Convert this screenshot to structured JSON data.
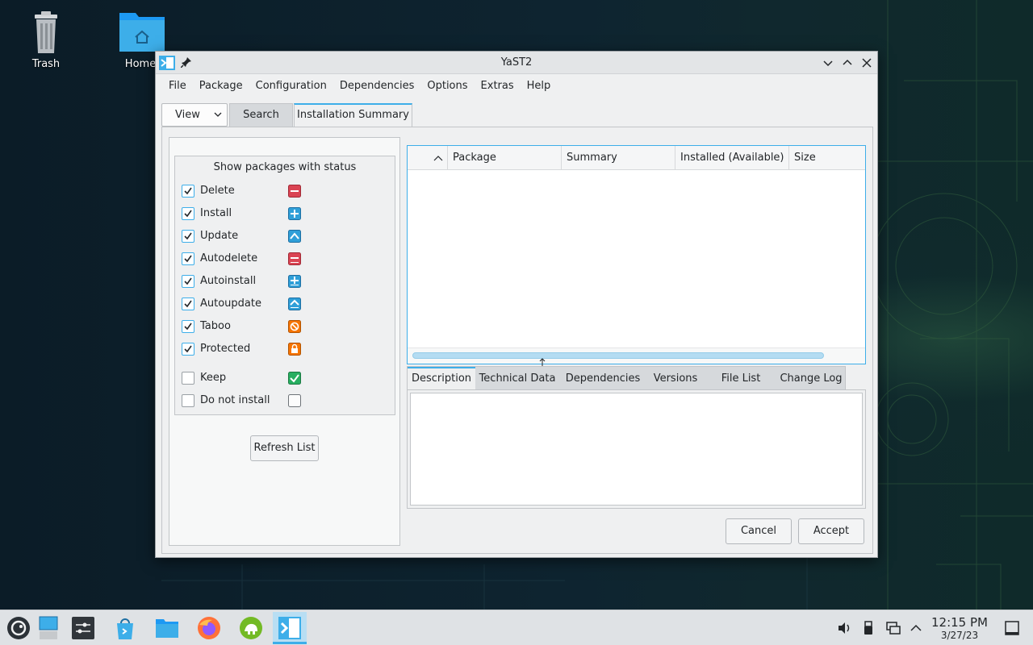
{
  "desktop": {
    "icons": [
      {
        "label": "Trash"
      },
      {
        "label": "Home"
      }
    ]
  },
  "window": {
    "title": "YaST2",
    "menu": [
      "File",
      "Package",
      "Configuration",
      "Dependencies",
      "Options",
      "Extras",
      "Help"
    ],
    "view_combo": "View",
    "tabs": [
      {
        "label": "Search",
        "active": false
      },
      {
        "label": "Installation Summary",
        "active": true
      }
    ],
    "status_filter": {
      "heading": "Show packages with status",
      "items": [
        {
          "label": "Delete",
          "checked": true,
          "icon": "delete-status-icon"
        },
        {
          "label": "Install",
          "checked": true,
          "icon": "install-status-icon"
        },
        {
          "label": "Update",
          "checked": true,
          "icon": "update-status-icon"
        },
        {
          "label": "Autodelete",
          "checked": true,
          "icon": "autodelete-status-icon"
        },
        {
          "label": "Autoinstall",
          "checked": true,
          "icon": "autoinstall-status-icon"
        },
        {
          "label": "Autoupdate",
          "checked": true,
          "icon": "autoupdate-status-icon"
        },
        {
          "label": "Taboo",
          "checked": true,
          "icon": "taboo-status-icon"
        },
        {
          "label": "Protected",
          "checked": true,
          "icon": "protected-status-icon"
        },
        {
          "label": "Keep",
          "checked": false,
          "icon": "keep-status-icon"
        },
        {
          "label": "Do not install",
          "checked": false,
          "icon": "do-not-install-status-icon"
        }
      ],
      "refresh_label": "Refresh List"
    },
    "package_table": {
      "columns": [
        "",
        "Package",
        "Summary",
        "Installed (Available)",
        "Size"
      ],
      "rows": []
    },
    "detail_tabs": [
      {
        "label": "Description",
        "active": true
      },
      {
        "label": "Technical Data",
        "active": false
      },
      {
        "label": "Dependencies",
        "active": false
      },
      {
        "label": "Versions",
        "active": false
      },
      {
        "label": "File List",
        "active": false
      },
      {
        "label": "Change Log",
        "active": false
      }
    ],
    "buttons": {
      "cancel": "Cancel",
      "accept": "Accept"
    }
  },
  "taskbar": {
    "time": "12:15 PM",
    "date": "3/27/23"
  },
  "colors": {
    "accent": "#3daee9",
    "delete": "#da4453",
    "install": "#2f9fd8",
    "taboo": "#f47750",
    "keep": "#27ae60"
  }
}
